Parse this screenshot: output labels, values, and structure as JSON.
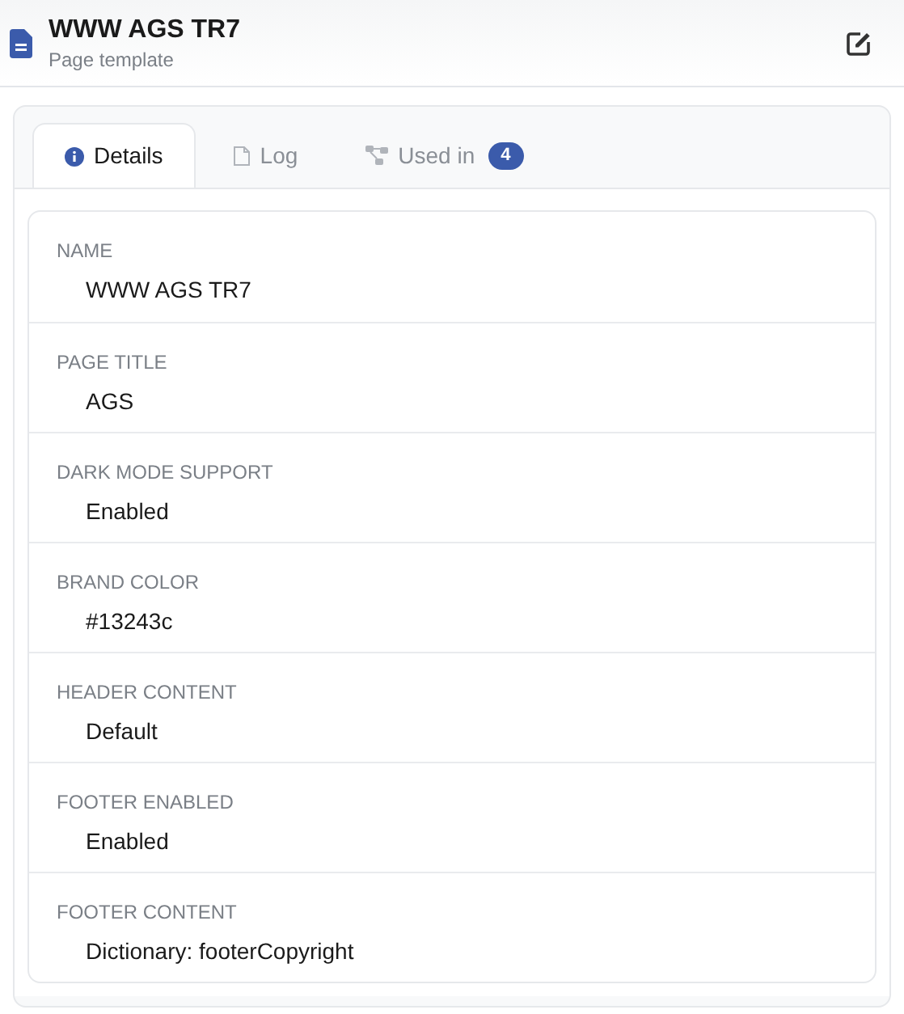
{
  "header": {
    "title": "WWW AGS TR7",
    "subtitle": "Page template"
  },
  "tabs": [
    {
      "kind": "info",
      "label": "Details",
      "selected": true
    },
    {
      "kind": "file",
      "label": "Log",
      "selected": false
    },
    {
      "kind": "tree",
      "label": "Used in",
      "count": "4",
      "selected": false
    }
  ],
  "fields": [
    {
      "label": "NAME",
      "value": "WWW AGS TR7"
    },
    {
      "label": "PAGE TITLE",
      "value": "AGS"
    },
    {
      "label": "DARK MODE SUPPORT",
      "value": "Enabled"
    },
    {
      "label": "BRAND COLOR",
      "value": "#13243c"
    },
    {
      "label": "HEADER CONTENT",
      "value": "Default"
    },
    {
      "label": "FOOTER ENABLED",
      "value": "Enabled"
    },
    {
      "label": "FOOTER CONTENT",
      "value": "Dictionary: footerCopyright"
    }
  ]
}
